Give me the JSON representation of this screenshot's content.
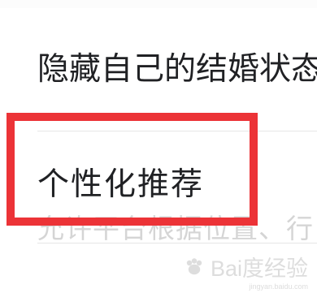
{
  "settings": {
    "item_1_label": "隐藏自己的结婚状态",
    "item_2_label": "个性化推荐",
    "item_2_description": "允许平台根据位置、行"
  },
  "watermark": {
    "text": "Bai度经验",
    "subtext": "jingyan.baidu.com"
  },
  "colors": {
    "highlight": "#ec3337",
    "text": "#202124",
    "muted": "#d5d5d5",
    "divider": "#e6e6e6"
  }
}
